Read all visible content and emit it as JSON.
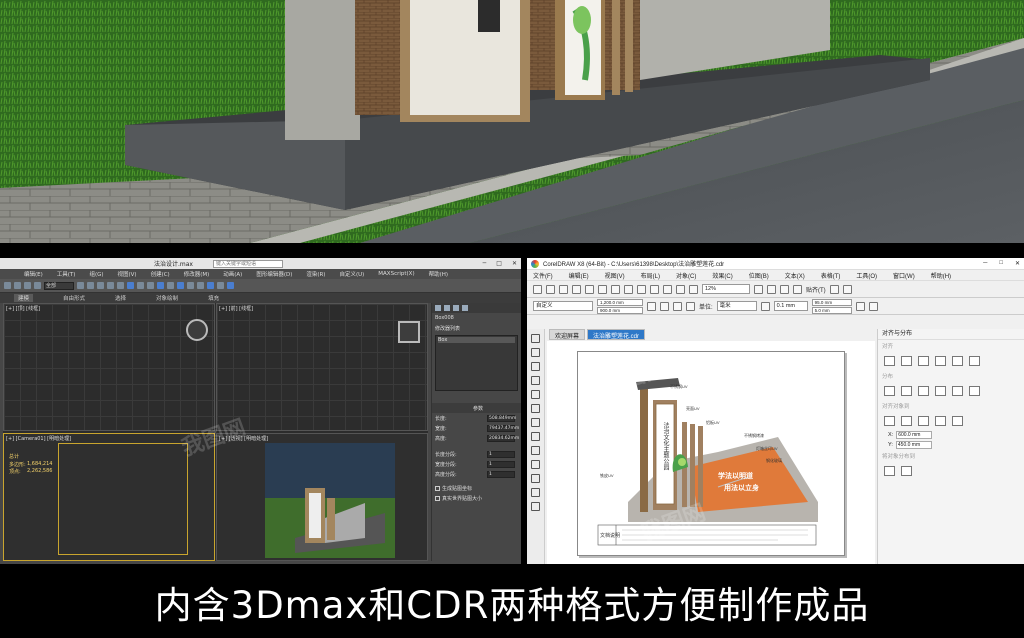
{
  "max": {
    "title": "法治设计.max",
    "search_placeholder": "键入关键字或短语",
    "menu": [
      "编辑(E)",
      "工具(T)",
      "组(G)",
      "视图(V)",
      "创建(C)",
      "修改器(M)",
      "动画(A)",
      "图形编辑器(D)",
      "渲染(R)",
      "自定义(U)",
      "MAXScript(X)",
      "帮助(H)"
    ],
    "selection_filter": "全部",
    "ribbon_tabs": [
      "建模",
      "自由形式",
      "选择",
      "对象绘制",
      "填充"
    ],
    "viewport_top_label": "[+] [顶] [线框]",
    "viewport_front_label": "[+] [前] [线框]",
    "viewport_camera_label": "[+] [Camera01] [明暗处理]",
    "viewport_persp_label": "[+] [透视] [明暗处理]",
    "stats": {
      "label": "总计",
      "polys_label": "多边形:",
      "polys": "1,684,214",
      "verts_label": "顶点:",
      "verts": "2,262,586"
    },
    "object_name": "Box008",
    "modifier_list_label": "修改器列表",
    "modifier_item": "Box",
    "params_header": "参数",
    "params": [
      {
        "label": "长度:",
        "value": "508.849mm"
      },
      {
        "label": "宽度:",
        "value": "79437.47mm"
      },
      {
        "label": "高度:",
        "value": "20834.62mm"
      },
      {
        "label": "长度分段:",
        "value": "1"
      },
      {
        "label": "宽度分段:",
        "value": "1"
      },
      {
        "label": "高度分段:",
        "value": "1"
      }
    ],
    "check_mapping": "生成贴图坐标",
    "check_real_world": "真实世界贴图大小"
  },
  "cdr": {
    "title": "CorelDRAW X8 (64-Bit) - C:\\Users\\61398\\Desktop\\法治雕塑莲花.cdr",
    "menu": [
      "文件(F)",
      "编辑(E)",
      "视图(V)",
      "布局(L)",
      "对象(C)",
      "效果(C)",
      "位图(B)",
      "文本(X)",
      "表格(T)",
      "工具(O)",
      "窗口(W)",
      "帮助(H)"
    ],
    "zoom": "12%",
    "snap_label": "贴齐(T)",
    "page_preset": "自定义",
    "page_w": "1,200.0 mm",
    "page_h": "900.0 mm",
    "units_label": "单位:",
    "units": "毫米",
    "nudge": "0.1 mm",
    "dup_x": "95.0 mm",
    "dup_y": "5.0 mm",
    "tabs": [
      "欢迎屏幕",
      "法治雕塑莲花.cdr"
    ],
    "docker_title": "对齐与分布",
    "docker_align_label": "对齐",
    "docker_distribute_label": "分布",
    "docker_dist_label": "对齐对象到",
    "docker_obj_label": "将对象分布到",
    "pos_x_label": "X:",
    "pos_x": "600.0 mm",
    "pos_y_label": "Y:",
    "pos_y": "450.0 mm",
    "drawing": {
      "vertical_text": "法治文化主题公园",
      "slogan_1": "学法以明道",
      "slogan_2": "用法以立身",
      "note_1": "不锈钢UV",
      "note_2": "亮面UV",
      "note_3": "铝板UV",
      "note_4": "不锈钢烤漆",
      "note_5": "灯箱丝印UV",
      "note_6": "钢化玻璃",
      "note_7": "铁皮UV",
      "legend_label": "文档说明"
    }
  },
  "caption": "内含3Dmax和CDR两种格式方便制作成品",
  "watermark": "我图网"
}
